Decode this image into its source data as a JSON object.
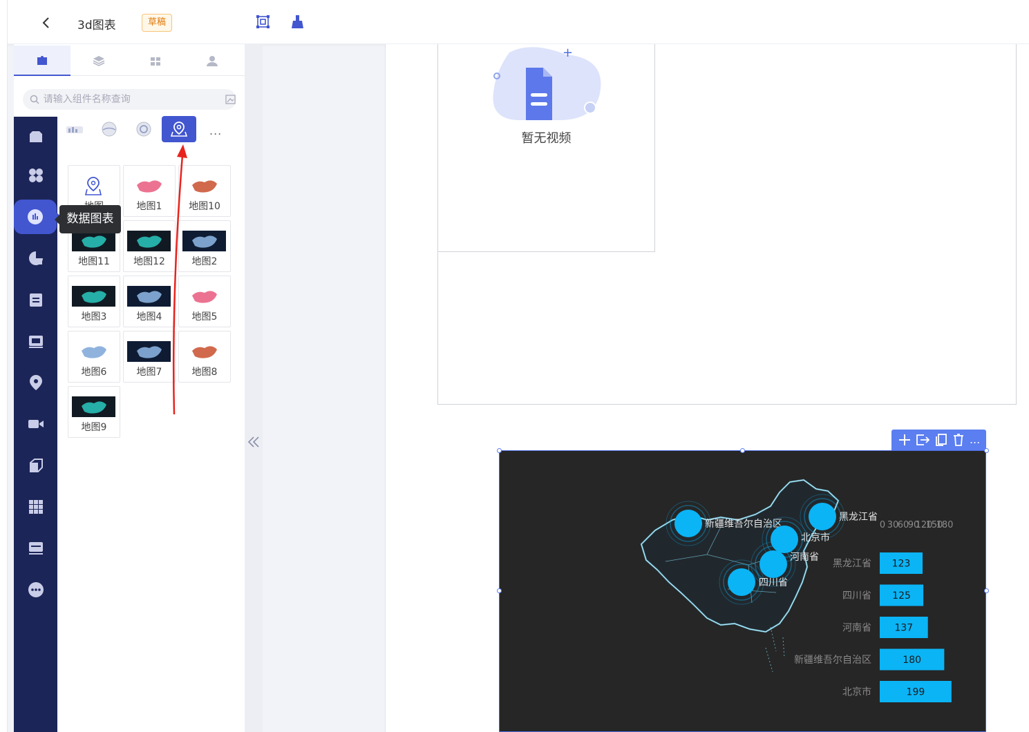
{
  "topbar": {
    "title": "3d图表",
    "draft_badge": "草稿"
  },
  "panel": {
    "search_placeholder": "请输入组件名称查询",
    "tooltip": "数据图表",
    "more": "...",
    "components": [
      {
        "label": "地图"
      },
      {
        "label": "地图1"
      },
      {
        "label": "地图10"
      },
      {
        "label": "地图11"
      },
      {
        "label": "地图12"
      },
      {
        "label": "地图2"
      },
      {
        "label": "地图3"
      },
      {
        "label": "地图4"
      },
      {
        "label": "地图5"
      },
      {
        "label": "地图6"
      },
      {
        "label": "地图7"
      },
      {
        "label": "地图8"
      },
      {
        "label": "地图9"
      }
    ]
  },
  "canvas": {
    "no_video": "暂无视频"
  },
  "chart_data": {
    "type": "bar",
    "categories": [
      "黑龙江省",
      "四川省",
      "河南省",
      "新疆维吾尔自治区",
      "北京市"
    ],
    "values": [
      123,
      125,
      137,
      180,
      199
    ],
    "x_axis_ticks": [
      "0",
      "30",
      "60",
      "90",
      "120",
      "150",
      "180"
    ],
    "map_points": [
      "新疆维吾尔自治区",
      "黑龙江省",
      "北京市",
      "河南省",
      "四川省"
    ],
    "bar_color": "#0bb4f5",
    "background": "#262626",
    "axis": "horizontal bars"
  }
}
